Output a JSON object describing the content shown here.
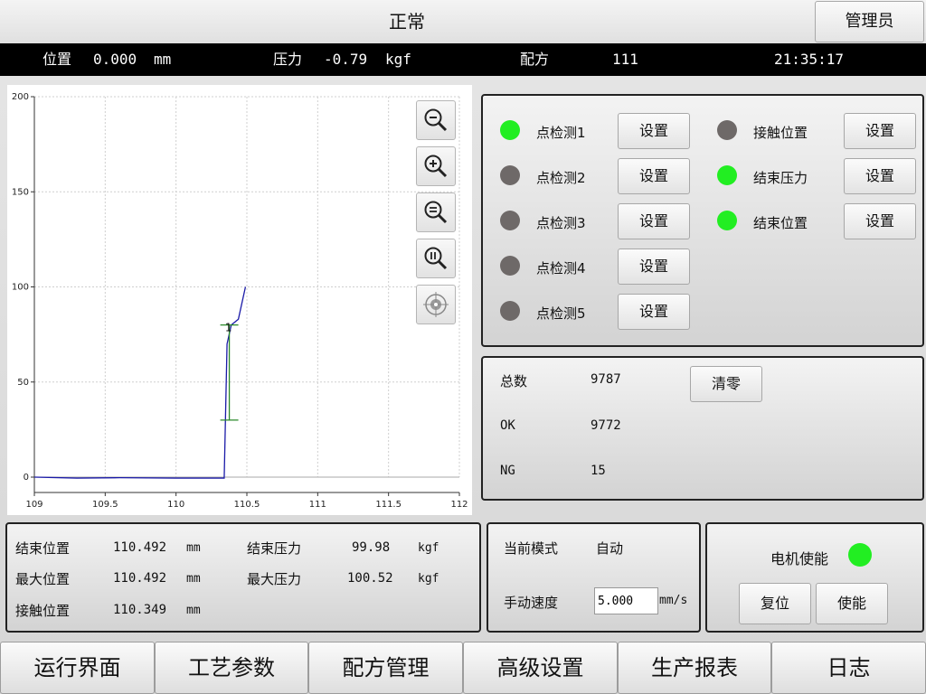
{
  "header": {
    "title": "正常",
    "admin_label": "管理员"
  },
  "status": {
    "position_label": "位置",
    "position_value": "0.000",
    "position_unit": "mm",
    "force_label": "压力",
    "force_value": "-0.79",
    "force_unit": "kgf",
    "recipe_label": "配方",
    "recipe_value": "111",
    "time": "21:35:17"
  },
  "chart_data": {
    "type": "line",
    "xlim": [
      109,
      112
    ],
    "ylim": [
      0,
      200
    ],
    "x_ticks": [
      "109",
      "109.5",
      "110",
      "110.5",
      "111",
      "111.5",
      "112"
    ],
    "y_ticks": [
      "0",
      "50",
      "100",
      "150",
      "200"
    ],
    "grid": true,
    "series": [
      {
        "color": "#1a1aa8",
        "x": [
          109.0,
          109.3,
          109.6,
          110.0,
          110.2,
          110.34,
          110.36,
          110.39,
          110.44,
          110.49
        ],
        "y": [
          0,
          -0.5,
          -0.3,
          -0.5,
          -0.5,
          -0.5,
          70,
          80,
          83,
          100
        ]
      }
    ],
    "markers": [
      {
        "type": "vertical-range",
        "color": "#2a8a2a",
        "x": 110.376,
        "y_min": 30,
        "y_max": 80
      }
    ],
    "annotations": [
      {
        "text": "1",
        "x": 110.37,
        "y": 79
      }
    ]
  },
  "detections": {
    "set_label": "设置",
    "left": [
      {
        "label": "点检测1",
        "status": "on"
      },
      {
        "label": "点检测2",
        "status": "off"
      },
      {
        "label": "点检测3",
        "status": "off"
      },
      {
        "label": "点检测4",
        "status": "off"
      },
      {
        "label": "点检测5",
        "status": "off"
      }
    ],
    "right": [
      {
        "label": "接触位置",
        "status": "off"
      },
      {
        "label": "结束压力",
        "status": "on"
      },
      {
        "label": "结束位置",
        "status": "on"
      }
    ]
  },
  "counts": {
    "total_label": "总数",
    "total_value": "9787",
    "ok_label": "OK",
    "ok_value": "9772",
    "ng_label": "NG",
    "ng_value": "15",
    "clear_label": "清零"
  },
  "results": {
    "end_pos_label": "结束位置",
    "end_pos_value": "110.492",
    "end_pos_unit": "mm",
    "max_pos_label": "最大位置",
    "max_pos_value": "110.492",
    "max_pos_unit": "mm",
    "contact_pos_label": "接触位置",
    "contact_pos_value": "110.349",
    "contact_pos_unit": "mm",
    "end_force_label": "结束压力",
    "end_force_value": "99.98",
    "end_force_unit": "kgf",
    "max_force_label": "最大压力",
    "max_force_value": "100.52",
    "max_force_unit": "kgf"
  },
  "mode": {
    "mode_label": "当前模式",
    "mode_value": "自动",
    "speed_label": "手动速度",
    "speed_value": "5.000",
    "speed_unit": "mm/s"
  },
  "motor": {
    "enable_label": "电机使能",
    "enable_status": "on",
    "reset_label": "复位",
    "enable_btn_label": "使能"
  },
  "nav": [
    {
      "label": "运行界面"
    },
    {
      "label": "工艺参数"
    },
    {
      "label": "配方管理"
    },
    {
      "label": "高级设置"
    },
    {
      "label": "生产报表"
    },
    {
      "label": "日志"
    }
  ],
  "colors": {
    "led_on": "#22ee22",
    "led_off": "#6e6968",
    "chart_line": "#1a1aa8",
    "marker": "#2a8a2a"
  }
}
